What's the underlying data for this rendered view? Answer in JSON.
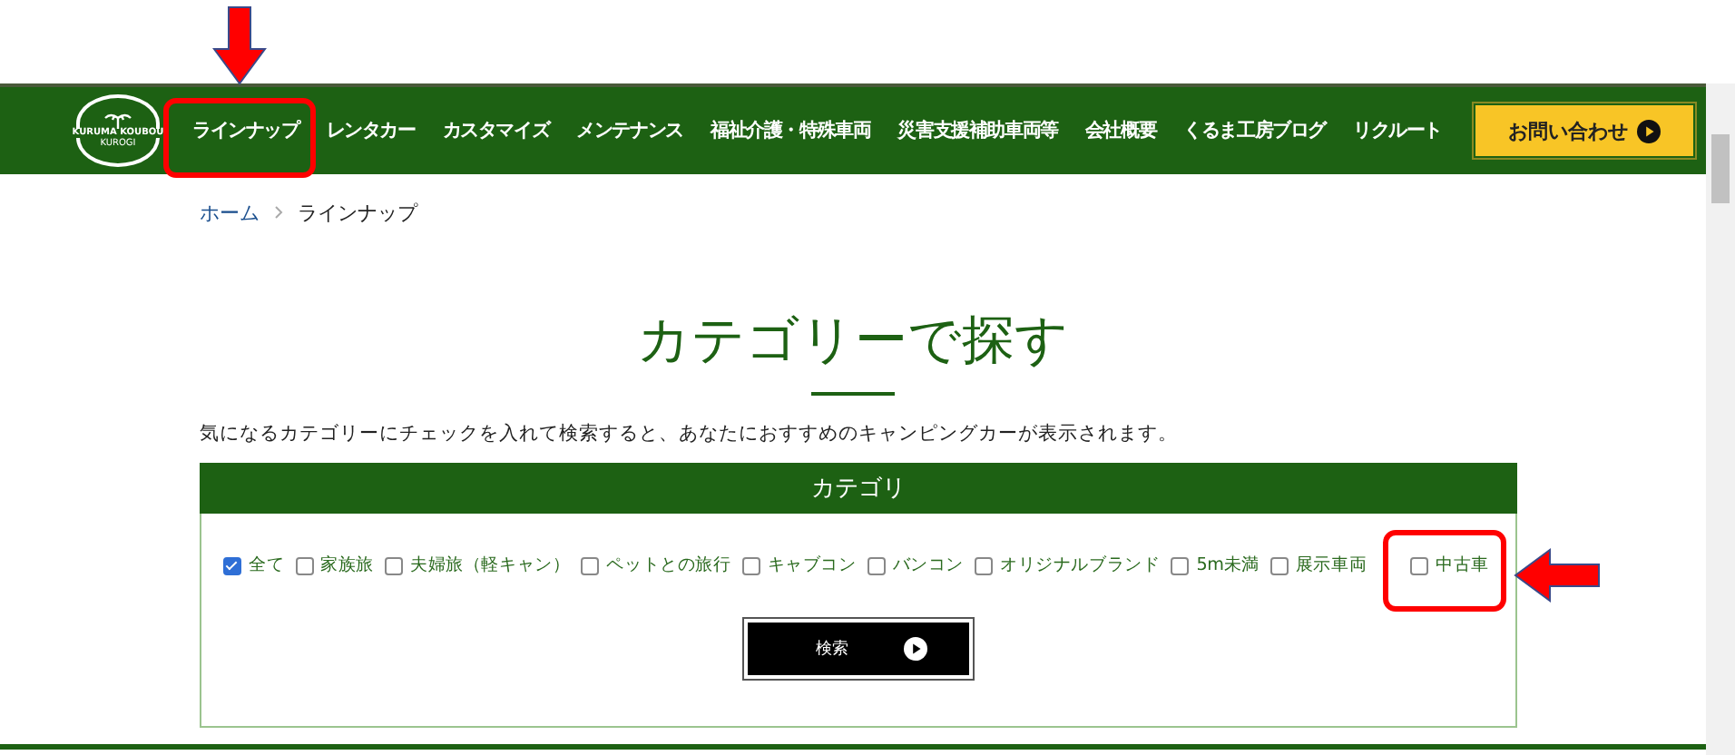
{
  "nav": {
    "logo": {
      "line1": "KURUMA KOUBOU",
      "line2": "KUROGI"
    },
    "items": [
      {
        "label": "ラインナップ"
      },
      {
        "label": "レンタカー"
      },
      {
        "label": "カスタマイズ"
      },
      {
        "label": "メンテナンス"
      },
      {
        "label": "福祉介護・特殊車両"
      },
      {
        "label": "災害支援補助車両等"
      },
      {
        "label": "会社概要"
      },
      {
        "label": "くるま工房ブログ"
      },
      {
        "label": "リクルート"
      }
    ],
    "contact_button": "お問い合わせ"
  },
  "breadcrumb": [
    "ホーム",
    "ラインナップ"
  ],
  "heading": "カテゴリーで探す",
  "description": "気になるカテゴリーにチェックを入れて検索すると、あなたにおすすめのキャンピングカーが表示されます。",
  "category_panel": {
    "title": "カテゴリ",
    "options": [
      {
        "label": "全て",
        "checked": true
      },
      {
        "label": "家族旅",
        "checked": false
      },
      {
        "label": "夫婦旅（軽キャン）",
        "checked": false
      },
      {
        "label": "ペットとの旅行",
        "checked": false
      },
      {
        "label": "キャブコン",
        "checked": false
      },
      {
        "label": "バンコン",
        "checked": false
      },
      {
        "label": "オリジナルブランド",
        "checked": false
      },
      {
        "label": "5m未満",
        "checked": false
      },
      {
        "label": "展示車両",
        "checked": false
      },
      {
        "label": "中古車",
        "checked": false
      }
    ],
    "search_button": "検索"
  }
}
